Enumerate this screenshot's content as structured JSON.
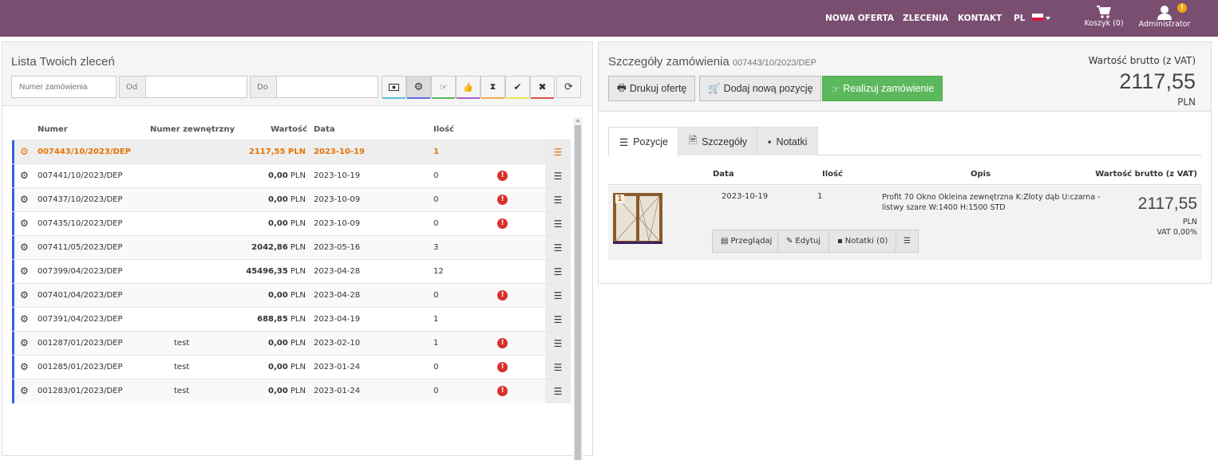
{
  "nav": {
    "items": [
      "NOWA OFERTA",
      "ZLECENIA",
      "KONTAKT"
    ],
    "lang": "PL",
    "cart_label": "Koszyk (0)",
    "user_label": "Administrator",
    "warn_badge": "!",
    "bar_color": "#7a4e70"
  },
  "orders": {
    "title": "Lista Twoich zleceń",
    "filters": {
      "order_placeholder": "Numer zamówienia",
      "from_label": "Od",
      "to_label": "Do",
      "status_buttons": [
        {
          "icon": "money-icon",
          "color": "#5bc0de"
        },
        {
          "icon": "gear-icon",
          "color": "#5b6ee1"
        },
        {
          "icon": "hand-point-right-icon",
          "color": "#5cb85c"
        },
        {
          "icon": "thumbs-up-icon",
          "color": "#b05cc8"
        },
        {
          "icon": "hourglass-icon",
          "color": "#f0ad4e"
        },
        {
          "icon": "check-icon",
          "color": "#f0e04e"
        },
        {
          "icon": "times-icon",
          "color": "#d9534f"
        }
      ],
      "refresh_icon": "refresh-icon"
    },
    "columns": {
      "numer": "Numer",
      "numer_zew": "Numer zewnętrzny",
      "wartosc": "Wartość",
      "data": "Data",
      "ilosc": "Ilość"
    },
    "rows": [
      {
        "numer": "007443/10/2023/DEP",
        "zew": "",
        "value": "2117,55",
        "cur": "PLN",
        "date": "2023-10-19",
        "qty": "1",
        "alert": false
      },
      {
        "numer": "007441/10/2023/DEP",
        "zew": "",
        "value": "0,00",
        "cur": "PLN",
        "date": "2023-10-19",
        "qty": "0",
        "alert": true
      },
      {
        "numer": "007437/10/2023/DEP",
        "zew": "",
        "value": "0,00",
        "cur": "PLN",
        "date": "2023-10-09",
        "qty": "0",
        "alert": true
      },
      {
        "numer": "007435/10/2023/DEP",
        "zew": "",
        "value": "0,00",
        "cur": "PLN",
        "date": "2023-10-09",
        "qty": "0",
        "alert": true
      },
      {
        "numer": "007411/05/2023/DEP",
        "zew": "",
        "value": "2042,86",
        "cur": "PLN",
        "date": "2023-05-16",
        "qty": "3",
        "alert": false
      },
      {
        "numer": "007399/04/2023/DEP",
        "zew": "",
        "value": "45496,35",
        "cur": "PLN",
        "date": "2023-04-28",
        "qty": "12",
        "alert": false
      },
      {
        "numer": "007401/04/2023/DEP",
        "zew": "",
        "value": "0,00",
        "cur": "PLN",
        "date": "2023-04-28",
        "qty": "0",
        "alert": true
      },
      {
        "numer": "007391/04/2023/DEP",
        "zew": "",
        "value": "688,85",
        "cur": "PLN",
        "date": "2023-04-19",
        "qty": "1",
        "alert": false
      },
      {
        "numer": "001287/01/2023/DEP",
        "zew": "test",
        "value": "0,00",
        "cur": "PLN",
        "date": "2023-02-10",
        "qty": "1",
        "alert": true
      },
      {
        "numer": "001285/01/2023/DEP",
        "zew": "test",
        "value": "0,00",
        "cur": "PLN",
        "date": "2023-01-24",
        "qty": "0",
        "alert": true
      },
      {
        "numer": "001283/01/2023/DEP",
        "zew": "test",
        "value": "0,00",
        "cur": "PLN",
        "date": "2023-01-24",
        "qty": "0",
        "alert": true
      }
    ]
  },
  "details": {
    "title": "Szczegóły zamówienia",
    "order_no": "007443/10/2023/DEP",
    "brutto_label": "Wartość brutto (z VAT)",
    "brutto_value": "2117,55",
    "brutto_currency": "PLN",
    "buttons": {
      "print": "Drukuj ofertę",
      "add": "Dodaj nową pozycję",
      "realize": "Realizuj zamówienie"
    },
    "tabs": [
      "Pozycje",
      "Szczegóły",
      "Notatki"
    ],
    "position_columns": {
      "data": "Data",
      "ilosc": "Ilość",
      "opis": "Opis",
      "wartosc": "Wartość brutto (z VAT)"
    },
    "position": {
      "index": "1",
      "date": "2023-10-19",
      "qty": "1",
      "desc_line1": "Profit 70 Okno Okleina zewnętrzna K:Złoty dąb U:czarna -",
      "desc_line2": "listwy szare W:1400 H:1500 STD",
      "value": "2117,55",
      "currency": "PLN",
      "vat": "VAT 0,00%",
      "actions": {
        "view": "Przeglądaj",
        "edit": "Edytuj",
        "notes": "Notatki (0)"
      }
    }
  }
}
